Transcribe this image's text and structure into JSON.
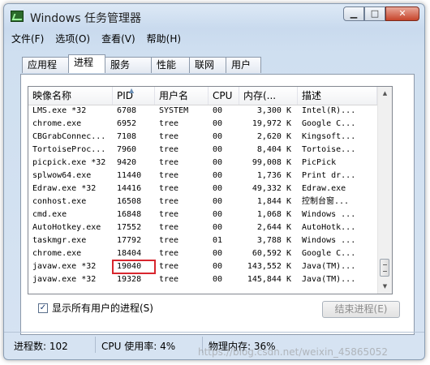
{
  "window": {
    "title": "Windows 任务管理器",
    "minimize_glyph": "▁",
    "maximize_glyph": "□",
    "close_glyph": "✕"
  },
  "menu": [
    "文件(F)",
    "选项(O)",
    "查看(V)",
    "帮助(H)"
  ],
  "tabs": [
    "应用程序",
    "进程",
    "服务",
    "性能",
    "联网",
    "用户"
  ],
  "active_tab": "进程",
  "columns": [
    "映像名称",
    "PID",
    "用户名",
    "CPU",
    "内存(...",
    "描述"
  ],
  "sort_column": "PID",
  "processes": [
    {
      "name": "LMS.exe *32",
      "pid": "6708",
      "user": "SYSTEM",
      "cpu": "00",
      "mem": "3,300 K",
      "desc": "Intel(R)..."
    },
    {
      "name": "chrome.exe",
      "pid": "6952",
      "user": "tree",
      "cpu": "00",
      "mem": "19,972 K",
      "desc": "Google C..."
    },
    {
      "name": "CBGrabConnec...",
      "pid": "7108",
      "user": "tree",
      "cpu": "00",
      "mem": "2,620 K",
      "desc": "Kingsoft..."
    },
    {
      "name": "TortoiseProc...",
      "pid": "7960",
      "user": "tree",
      "cpu": "00",
      "mem": "8,404 K",
      "desc": "Tortoise..."
    },
    {
      "name": "picpick.exe *32",
      "pid": "9420",
      "user": "tree",
      "cpu": "00",
      "mem": "99,008 K",
      "desc": "PicPick"
    },
    {
      "name": "splwow64.exe",
      "pid": "11440",
      "user": "tree",
      "cpu": "00",
      "mem": "1,736 K",
      "desc": "Print dr..."
    },
    {
      "name": "Edraw.exe *32",
      "pid": "14416",
      "user": "tree",
      "cpu": "00",
      "mem": "49,332 K",
      "desc": "Edraw.exe"
    },
    {
      "name": "conhost.exe",
      "pid": "16508",
      "user": "tree",
      "cpu": "00",
      "mem": "1,844 K",
      "desc": "控制台窗..."
    },
    {
      "name": "cmd.exe",
      "pid": "16848",
      "user": "tree",
      "cpu": "00",
      "mem": "1,068 K",
      "desc": "Windows ..."
    },
    {
      "name": "AutoHotkey.exe",
      "pid": "17552",
      "user": "tree",
      "cpu": "00",
      "mem": "2,644 K",
      "desc": "AutoHotk..."
    },
    {
      "name": "taskmgr.exe",
      "pid": "17792",
      "user": "tree",
      "cpu": "01",
      "mem": "3,788 K",
      "desc": "Windows ..."
    },
    {
      "name": "chrome.exe",
      "pid": "18404",
      "user": "tree",
      "cpu": "00",
      "mem": "60,592 K",
      "desc": "Google C..."
    },
    {
      "name": "javaw.exe *32",
      "pid": "19040",
      "user": "tree",
      "cpu": "00",
      "mem": "143,552 K",
      "desc": "Java(TM)..."
    },
    {
      "name": "javaw.exe *32",
      "pid": "19328",
      "user": "tree",
      "cpu": "00",
      "mem": "145,844 K",
      "desc": "Java(TM)..."
    }
  ],
  "highlighted_pid": "19040",
  "show_all_label": "显示所有用户的进程(S)",
  "show_all_checked": true,
  "end_process_label": "结束进程(E)",
  "status": {
    "processes": "进程数: 102",
    "cpu": "CPU 使用率: 4%",
    "memory": "物理内存: 36%"
  },
  "watermark": "https://blog.csdn.net/weixin_45865052",
  "colors": {
    "highlight": "#d8262e",
    "frame": "#cfdff0"
  }
}
